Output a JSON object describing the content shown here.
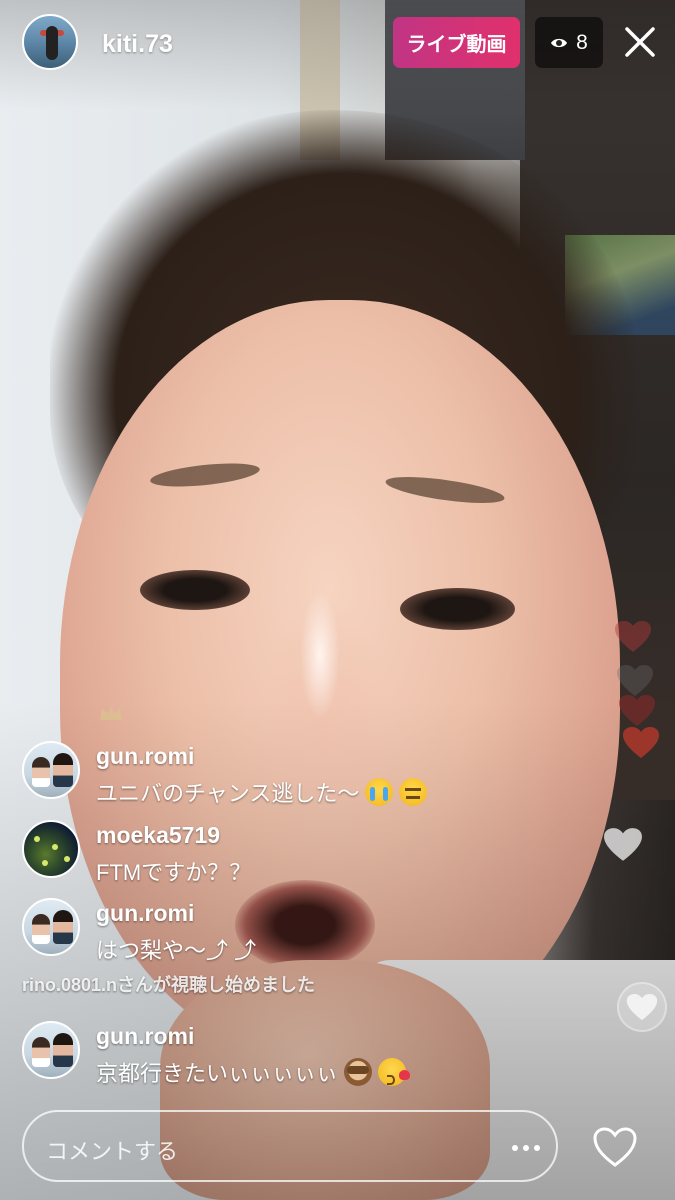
{
  "header": {
    "host_name": "kiti.73",
    "live_label": "ライブ動画",
    "viewer_count": "8"
  },
  "comments": [
    {
      "user": "gun.romi",
      "text": "ユニバのチャンス逃した〜",
      "emojis": [
        "loudly-crying-face",
        "expressionless-face"
      ]
    },
    {
      "user": "moeka5719",
      "text": "FTMですか？？",
      "emojis": []
    },
    {
      "user": "gun.romi",
      "text": "はつ梨や〜⤴︎ ⤴︎",
      "emojis": []
    },
    {
      "user": "gun.romi",
      "text": "京都行きたいぃぃぃぃぃ",
      "emojis": [
        "see-no-evil-monkey",
        "face-blowing-kiss"
      ]
    }
  ],
  "join_notice": "rino.0801.nさんが視聴し始めました",
  "comment_bar": {
    "placeholder": "コメントする"
  },
  "icons": {
    "viewers": "eye-icon",
    "close": "close-icon",
    "more": "more-icon",
    "like": "heart-icon"
  },
  "colors": {
    "live_badge_start": "#c13584",
    "live_badge_end": "#e1306c",
    "floating_heart": "#c0392b"
  }
}
